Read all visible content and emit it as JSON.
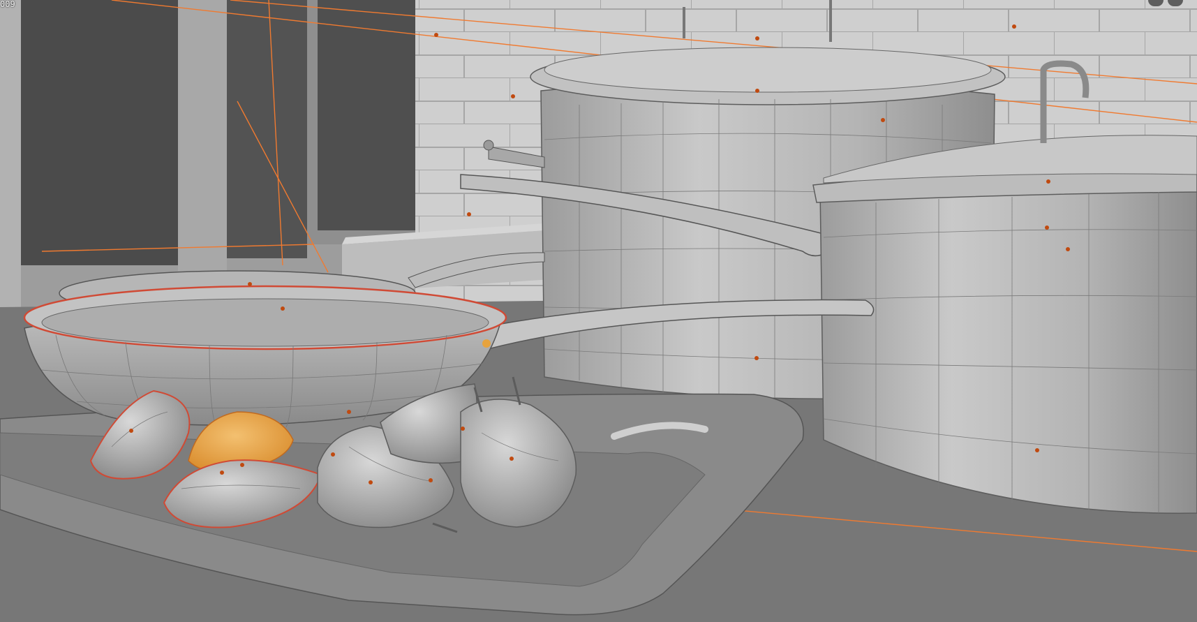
{
  "viewport": {
    "frame_label": "009",
    "mode": "edit-mode-wireframe-overlay"
  },
  "colors": {
    "background": "#7b7b7b",
    "wall": "#cfcfcf",
    "brick_lines": "#a9a9a9",
    "floor": "#7a7a7a",
    "dark_door": "#4a4a4a",
    "mesh": "#b9b9b9",
    "wire": "#5c5c5c",
    "selected_edges": "#d04a35",
    "active_face": "#e7a33e",
    "light_lines": "#f07a30",
    "origin_points": "#c04a10"
  },
  "navigation": {
    "buttons": [
      "gizmo-orbit-icon",
      "gizmo-zoom-icon"
    ]
  }
}
